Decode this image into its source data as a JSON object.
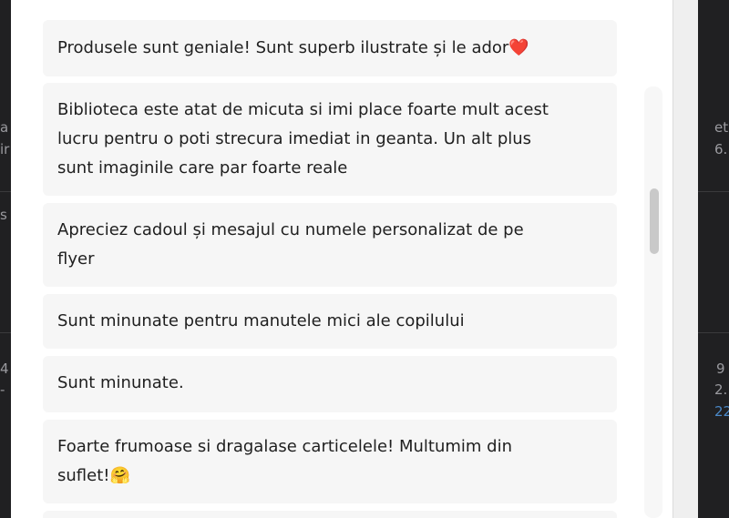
{
  "background": {
    "fragments_left": [
      "a",
      "ir",
      "s",
      "4",
      "-"
    ],
    "fragments_right": [
      "et",
      "6.",
      "9",
      "2.",
      "22"
    ]
  },
  "reviews": [
    {
      "text": "Produsele sunt geniale! Sunt superb ilustrate și le ador❤️"
    },
    {
      "text": "Biblioteca este atat de micuta si imi place foarte mult acest\nlucru pentru o poti strecura imediat in geanta. Un alt plus\nsunt imaginile care par foarte reale"
    },
    {
      "text": "Apreciez cadoul și mesajul cu numele personalizat de pe\nflyer"
    },
    {
      "text": "Sunt minunate pentru manutele mici ale copilului"
    },
    {
      "text": "Sunt minunate."
    },
    {
      "text": "Foarte frumoase si dragalase carticelele! Multumim din\nsuflet!🤗"
    }
  ],
  "colors": {
    "card_background": "#f6f6f6",
    "text": "#1f1f1f",
    "page_backdrop": "#202022"
  },
  "icons": [
    "scroll-thumb"
  ]
}
